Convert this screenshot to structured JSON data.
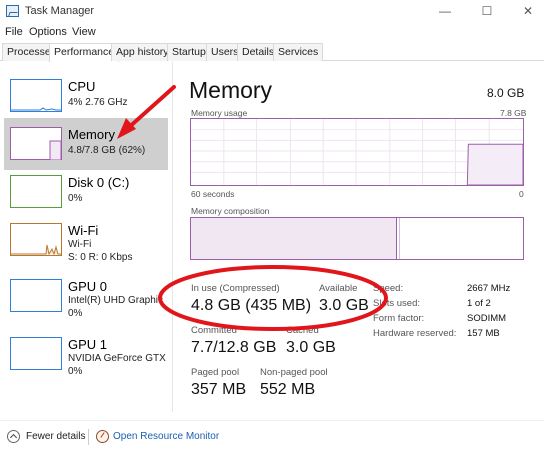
{
  "window": {
    "title": "Task Manager",
    "minimize_glyph": "—",
    "maximize_glyph": "☐",
    "close_glyph": "✕"
  },
  "menu": [
    "File",
    "Options",
    "View"
  ],
  "tabs": [
    "Processes",
    "Performance",
    "App history",
    "Startup",
    "Users",
    "Details",
    "Services"
  ],
  "active_tab": "Performance",
  "sidebar": {
    "items": [
      {
        "name": "CPU",
        "line1": "4% 2.76 GHz",
        "line2": "",
        "color": "#2f7fd8"
      },
      {
        "name": "Memory",
        "line1": "4.8/7.8 GB (62%)",
        "line2": "",
        "color": "#9b5fa8"
      },
      {
        "name": "Disk 0 (C:)",
        "line1": "0%",
        "line2": "",
        "color": "#5a9b3a"
      },
      {
        "name": "Wi-Fi",
        "line1": "Wi-Fi",
        "line2": "S: 0 R: 0 Kbps",
        "color": "#b8762e"
      },
      {
        "name": "GPU 0",
        "line1": "Intel(R) UHD Graphic",
        "line2": "0%",
        "color": "#2f7fd8"
      },
      {
        "name": "GPU 1",
        "line1": "NVIDIA GeForce GTX",
        "line2": "0%",
        "color": "#2f7fd8"
      }
    ]
  },
  "memory": {
    "title": "Memory",
    "total": "8.0 GB",
    "usage_label": "Memory usage",
    "usage_max": "7.8 GB",
    "time_span": "60 seconds",
    "time_end": "0",
    "composition_label": "Memory composition",
    "in_use_fraction": 0.62,
    "stats": {
      "in_use_label": "In use (Compressed)",
      "in_use_value": "4.8 GB (435 MB)",
      "available_label": "Available",
      "available_value": "3.0 GB",
      "committed_label": "Committed",
      "committed_value": "7.7/12.8 GB",
      "cached_label": "Cached",
      "cached_value": "3.0 GB",
      "paged_pool_label": "Paged pool",
      "paged_pool_value": "357 MB",
      "non_paged_pool_label": "Non-paged pool",
      "non_paged_pool_value": "552 MB"
    },
    "specs": [
      {
        "label": "Speed:",
        "value": "2667 MHz"
      },
      {
        "label": "Slots used:",
        "value": "1 of 2"
      },
      {
        "label": "Form factor:",
        "value": "SODIMM"
      },
      {
        "label": "Hardware reserved:",
        "value": "157 MB"
      }
    ]
  },
  "footer": {
    "fewer_details": "Fewer details",
    "open_resource_monitor": "Open Resource Monitor"
  },
  "annotation_color": "#e0161b"
}
